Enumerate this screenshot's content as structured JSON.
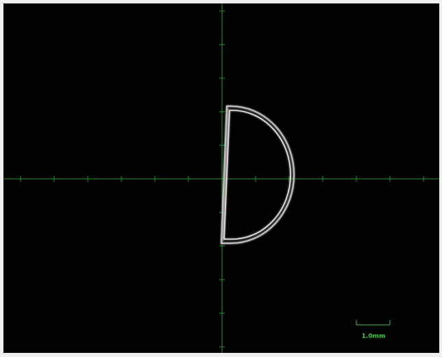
{
  "viewer": {
    "background": "#000000",
    "frame_color": "#efefef",
    "crosshair_color": "#1f9e1f",
    "specimen_color": "#d9d9d9",
    "scale_bar_color": "#2ecc40"
  },
  "scale_bar": {
    "label": "1.0mm"
  },
  "specimen": {
    "shape": "semicircle (D-shaped) outline",
    "icon": "d-shaped-specimen-outline"
  }
}
